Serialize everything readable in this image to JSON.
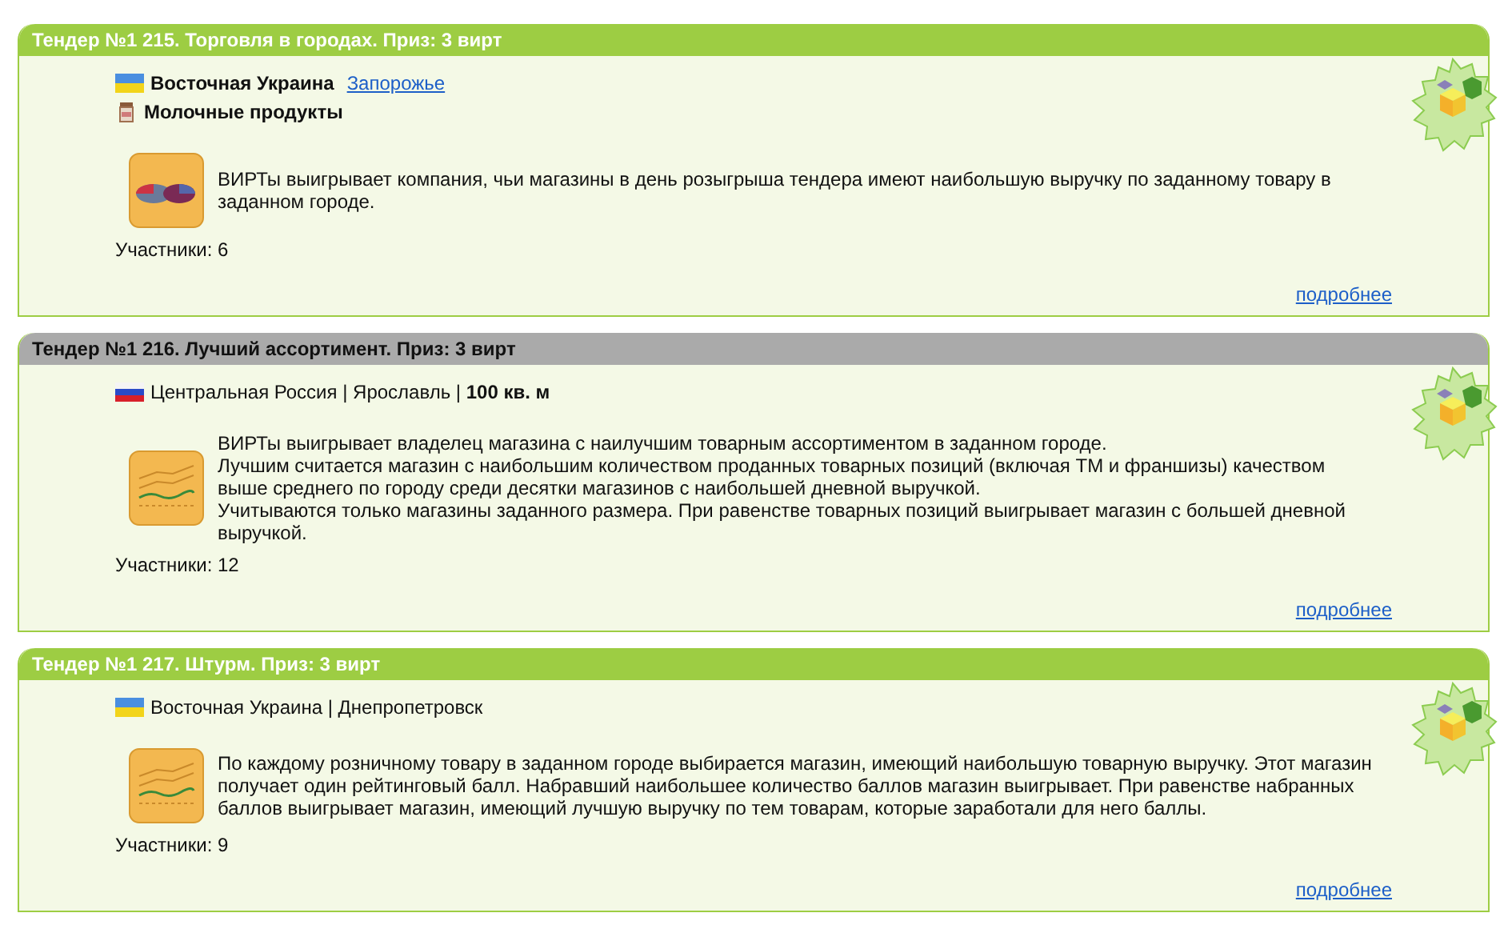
{
  "tenders": [
    {
      "title": "Тендер №1 215. Торговля в городах. Приз: 3 вирт",
      "color": "#9dcd43",
      "location": {
        "kind": "ukraine",
        "text": "Восточная Украина",
        "bold": true,
        "link": "Запорожье"
      },
      "product": {
        "name": "Молочные продукты"
      },
      "kind": "pie",
      "paragraphs": [
        "ВИРТы выигрывает компания, чьи магазины в день розыгрыша тендера имеют наибольшую выручку по заданному товару в заданном городе."
      ],
      "participants": "Участники: 6",
      "more": "подробнее"
    },
    {
      "title": "Тендер №1 216. Лучший ассортимент. Приз: 3 вирт",
      "color": "#aaaaaa",
      "location": {
        "kind": "russia",
        "text": "Центральная Россия | Ярославль | **100 кв. м**",
        "bold": false
      },
      "kind": "chart",
      "paragraphs": [
        "ВИРТы выигрывает владелец магазина с наилучшим товарным ассортиментом в заданном городе.",
        "Лучшим считается магазин с наибольшим количеством проданных товарных позиций (включая ТМ и франшизы) качеством выше среднего по городу среди десятки магазинов с наибольшей дневной выручкой.",
        "Учитываются только магазины заданного размера. При равенстве товарных позиций выигрывает магазин с большей дневной выручкой."
      ],
      "participants": "Участники: 12",
      "more": "подробнее"
    },
    {
      "title": "Тендер №1 217. Штурм. Приз: 3 вирт",
      "color": "#9dcd43",
      "location": {
        "kind": "ukraine",
        "text": "Восточная Украина | Днепропетровск",
        "bold": false
      },
      "kind": "chart",
      "paragraphs": [
        "По каждому розничному товару в заданном городе выбирается магазин, имеющий наибольшую товарную выручку. Этот магазин получает один рейтинговый балл. Набравший наибольшее количество баллов магазин выигрывает. При равенстве набранных баллов выигрывает магазин, имеющий лучшую выручку по тем товарам, которые заработали для него баллы."
      ],
      "participants": "Участники: 9",
      "more": "подробнее"
    }
  ]
}
